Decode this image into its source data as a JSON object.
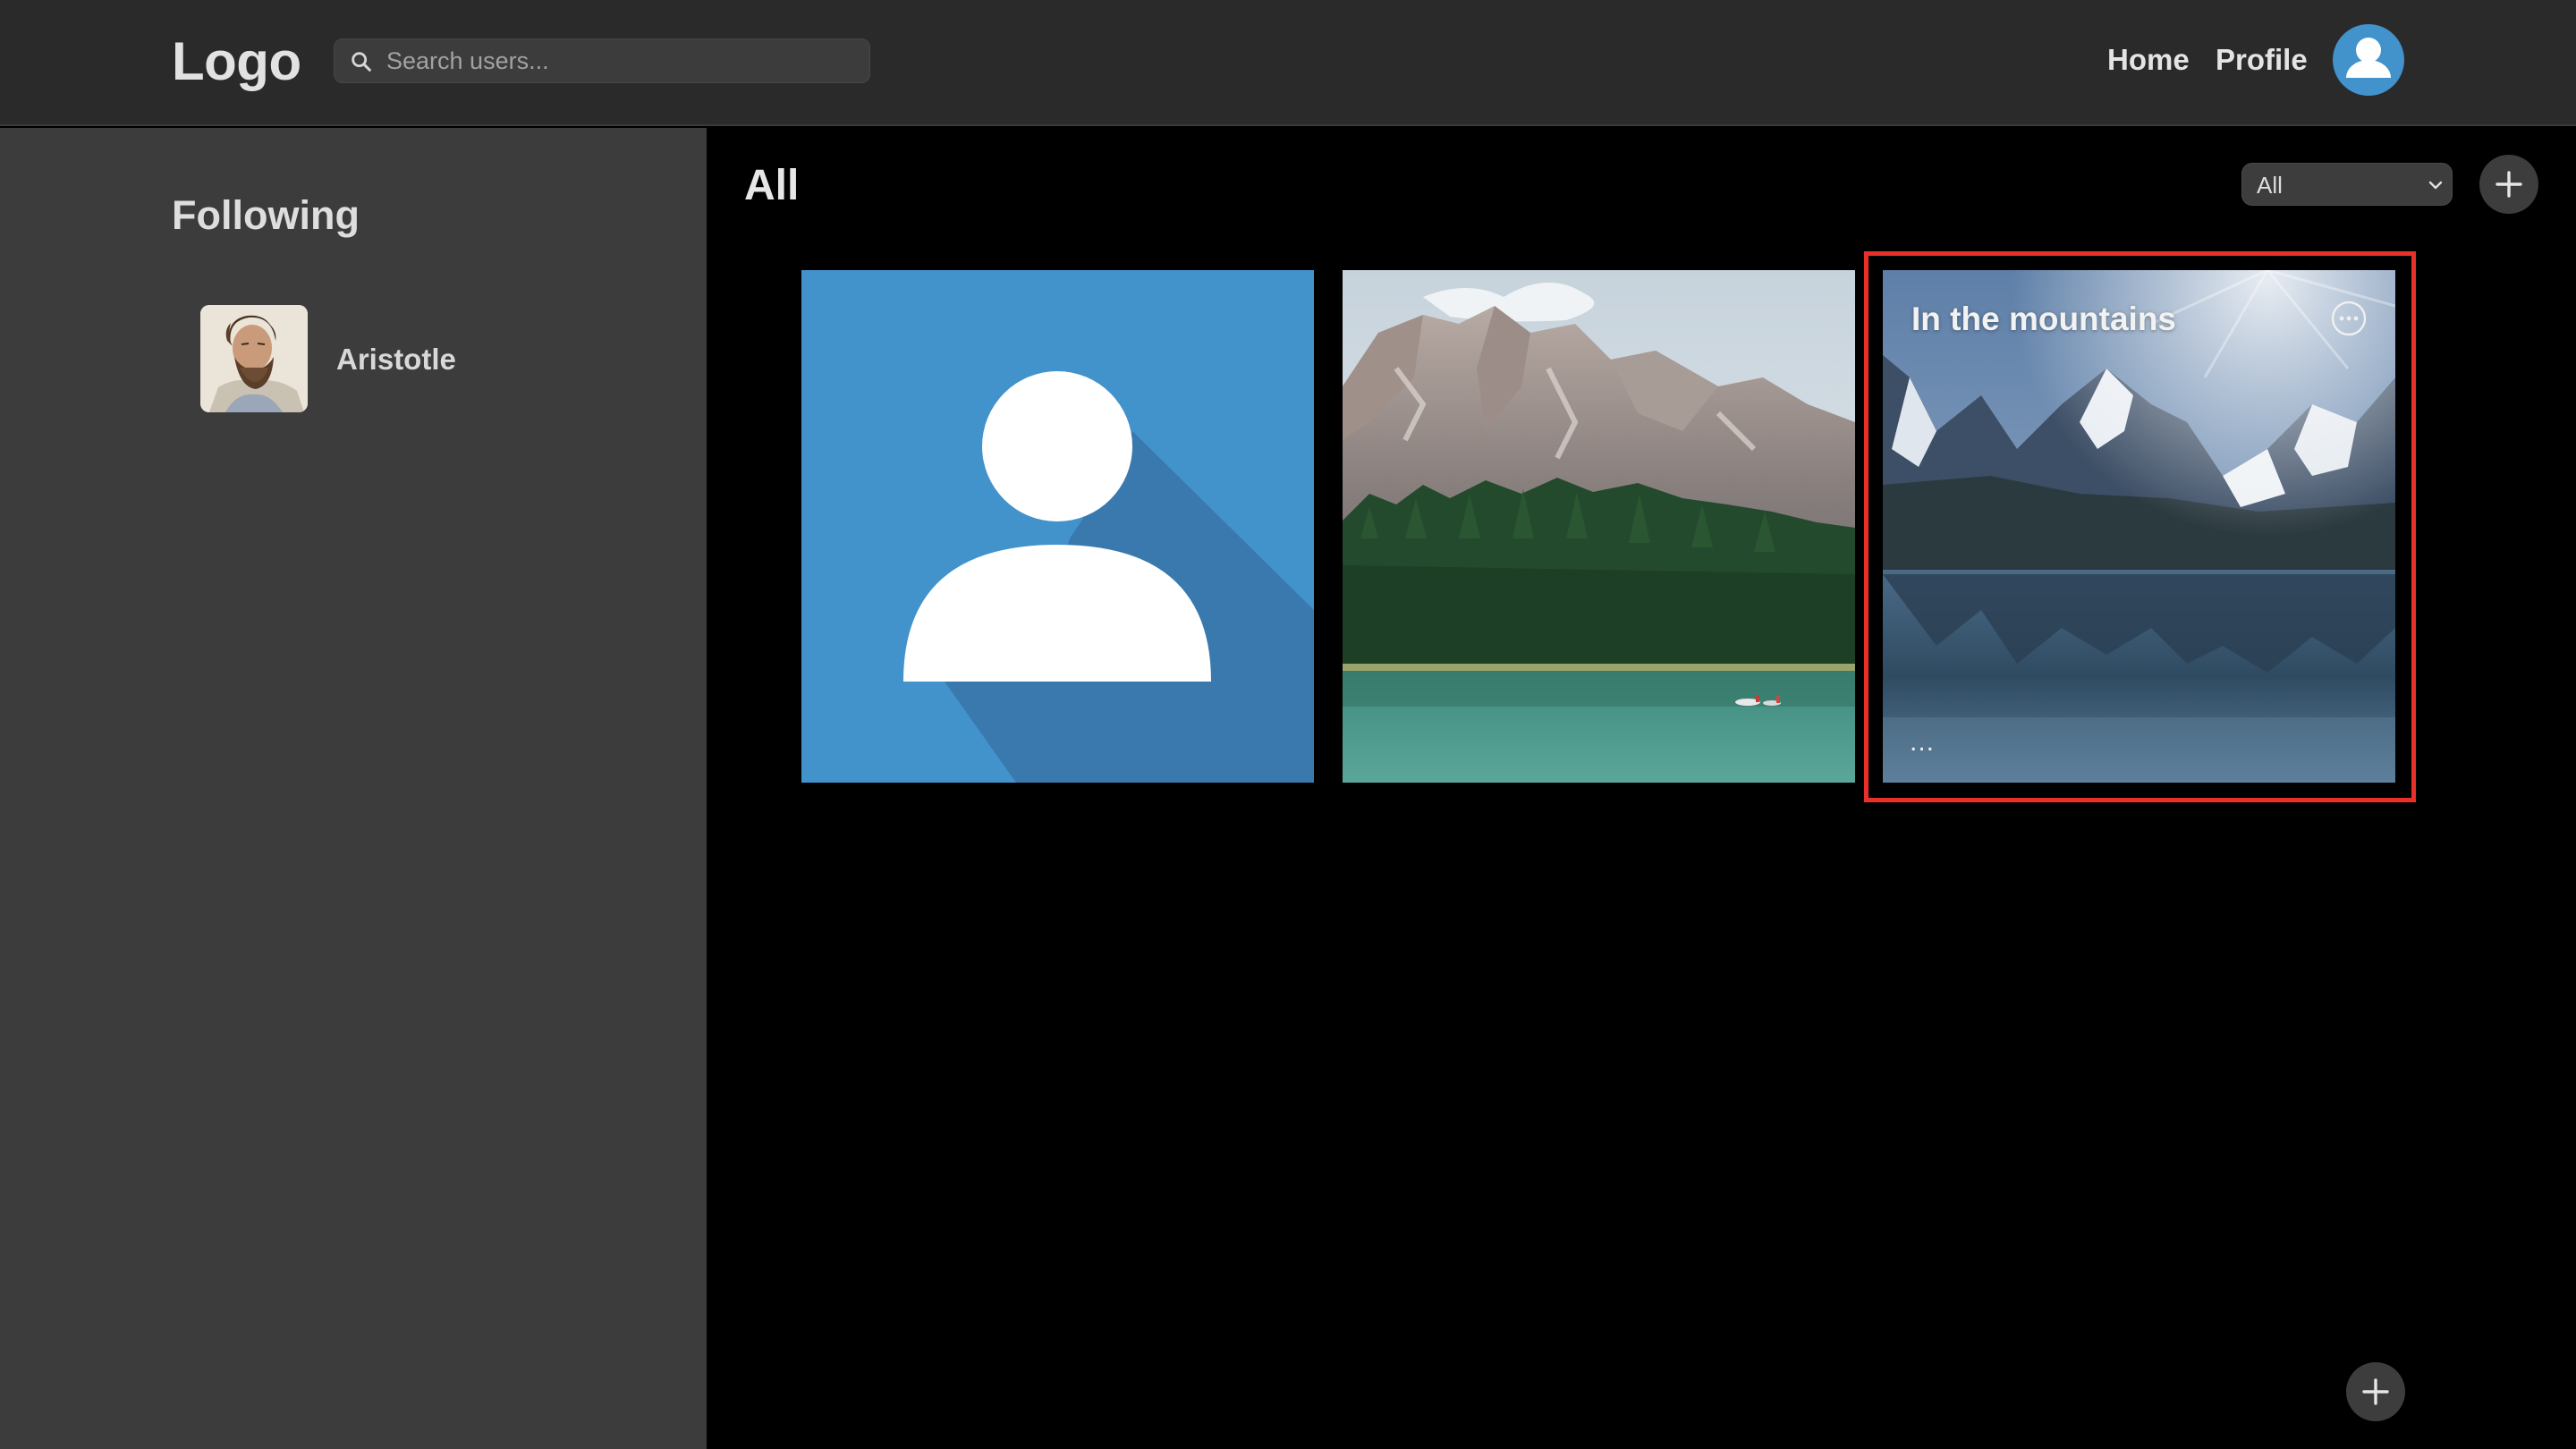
{
  "header": {
    "logo": "Logo",
    "search_placeholder": "Search users...",
    "nav": {
      "home": "Home",
      "profile": "Profile"
    },
    "avatar_icon": "user-avatar-icon"
  },
  "sidebar": {
    "title": "Following",
    "items": [
      {
        "name": "Aristotle",
        "icon": "aristotle-portrait"
      }
    ]
  },
  "main": {
    "title": "All",
    "filter": {
      "selected": "All",
      "icon": "chevron-down-icon"
    },
    "add_icon": "plus-icon",
    "cards": [
      {
        "type": "default-avatar",
        "title": ""
      },
      {
        "type": "photo",
        "title": ""
      },
      {
        "type": "photo",
        "title": "In the mountains",
        "more_icon": "more-options-icon",
        "dots": "..."
      }
    ]
  },
  "colors": {
    "accent_blue": "#4292cc",
    "highlight_red": "#e8302a",
    "topbar": "#2a2a2a",
    "sidebar": "#3c3c3c"
  }
}
